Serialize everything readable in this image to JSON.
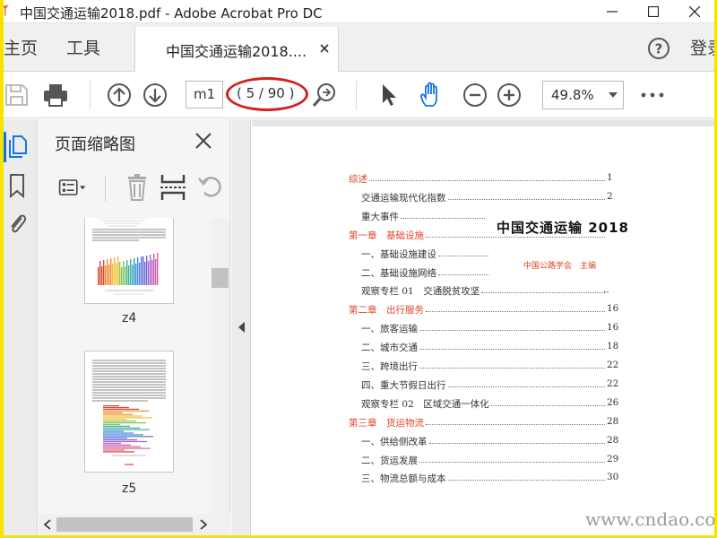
{
  "window": {
    "title": "中国交通运输2018.pdf - Adobe Acrobat Pro DC"
  },
  "tabs": {
    "home": "主页",
    "tools": "工具",
    "document": "中国交通运输2018....",
    "login": "登录"
  },
  "toolbar": {
    "page_input": "m1",
    "page_count": "( 5 / 90 )",
    "zoom": "49.8%"
  },
  "thumbnails": {
    "title": "页面缩略图",
    "items": [
      {
        "label": "z4"
      },
      {
        "label": "z5"
      }
    ]
  },
  "document": {
    "title": "中国交通运输 2018",
    "editor": "中国公路学会　主编",
    "toc": [
      {
        "text": "综述",
        "page": "1",
        "kind": "chapter"
      },
      {
        "text": "交通运输现代化指数",
        "page": "2",
        "kind": "sub"
      },
      {
        "text": "重大事件",
        "page": "",
        "kind": "sub"
      },
      {
        "text": "第一章　基础设施",
        "page": "",
        "kind": "chapter"
      },
      {
        "text": "一、基础设施建设",
        "page": "",
        "kind": "sub"
      },
      {
        "text": "二、基础设施网络",
        "page": "",
        "kind": "sub"
      },
      {
        "text": "观察专栏 01　交通脱贫攻坚",
        "page": "..",
        "kind": "sub"
      },
      {
        "text": "第二章　出行服务",
        "page": "16",
        "kind": "chapter"
      },
      {
        "text": "一、旅客运输",
        "page": "16",
        "kind": "sub"
      },
      {
        "text": "二、城市交通",
        "page": "18",
        "kind": "sub"
      },
      {
        "text": "三、跨境出行",
        "page": "22",
        "kind": "sub"
      },
      {
        "text": "四、重大节假日出行",
        "page": "22",
        "kind": "sub"
      },
      {
        "text": "观察专栏 02　区域交通一体化",
        "page": "26",
        "kind": "sub"
      },
      {
        "text": "第三章　货运物流",
        "page": "28",
        "kind": "chapter"
      },
      {
        "text": "一、供给侧改革",
        "page": "28",
        "kind": "sub"
      },
      {
        "text": "二、货运发展",
        "page": "29",
        "kind": "sub"
      },
      {
        "text": "三、物流总额与成本",
        "page": "30",
        "kind": "sub"
      }
    ]
  },
  "watermark": "www.cndao.com",
  "colors": {
    "accent_blue": "#1473e6",
    "chapter_red": "#e0442a",
    "highlight_red": "#d12020",
    "frame_yellow": "#f5e400"
  },
  "icons": [
    "save-icon",
    "print-icon",
    "page-up-icon",
    "page-down-icon",
    "find-icon",
    "select-arrow-icon",
    "hand-icon",
    "zoom-out-icon",
    "zoom-in-icon",
    "more-icon",
    "pages-icon",
    "bookmark-icon",
    "attachment-icon",
    "help-icon"
  ]
}
